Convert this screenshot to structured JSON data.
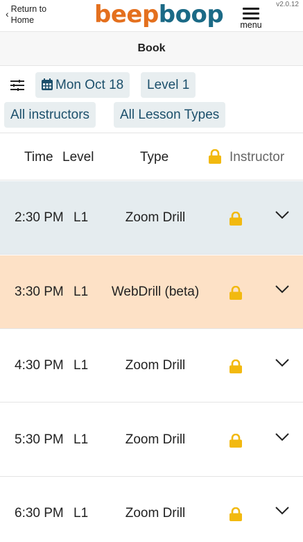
{
  "header": {
    "back_chevron": "‹",
    "back_label": "Return to Home",
    "logo_part1": "beep",
    "logo_part2": "boop",
    "menu_label": "menu",
    "version": "v2.0.12"
  },
  "page": {
    "title": "Book"
  },
  "filters": {
    "date": "Mon Oct 18",
    "level": "Level 1",
    "instructors": "All instructors",
    "lesson_types": "All Lesson Types"
  },
  "table": {
    "columns": {
      "time": "Time",
      "level": "Level",
      "type": "Type",
      "instructor": "Instructor"
    },
    "rows": [
      {
        "time": "2:30 PM",
        "level": "L1",
        "type": "Zoom Drill",
        "bg": "#e5ecef"
      },
      {
        "time": "3:30 PM",
        "level": "L1",
        "type": "WebDrill (beta)",
        "bg": "#fde1c6"
      },
      {
        "time": "4:30 PM",
        "level": "L1",
        "type": "Zoom Drill",
        "bg": "#ffffff"
      },
      {
        "time": "5:30 PM",
        "level": "L1",
        "type": "Zoom Drill",
        "bg": "#ffffff"
      },
      {
        "time": "6:30 PM",
        "level": "L1",
        "type": "Zoom Drill",
        "bg": "#ffffff"
      }
    ]
  },
  "icons": {
    "back": "chevron-left-icon",
    "menu": "hamburger-menu-icon",
    "filter": "sliders-icon",
    "date": "calendar-icon",
    "lock": "lock-icon",
    "expand": "chevron-down-icon"
  },
  "colors": {
    "brand_orange": "#e4701e",
    "brand_teal": "#1b6a86",
    "chip_bg": "#e8eef0",
    "chip_text": "#1b4f6b",
    "lock": "#f2b90f"
  }
}
